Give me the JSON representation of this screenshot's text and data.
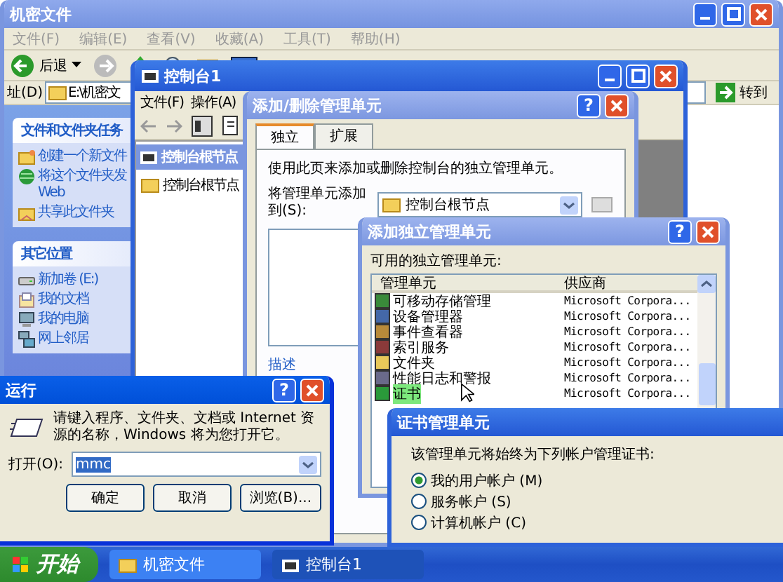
{
  "explorer": {
    "title": "机密文件",
    "menu": [
      "文件(F)",
      "编辑(E)",
      "查看(V)",
      "收藏(A)",
      "工具(T)",
      "帮助(H)"
    ],
    "toolbar": [
      {
        "kind": "back",
        "label": "后退"
      },
      {
        "kind": "forward"
      },
      {
        "kind": "up"
      },
      {
        "kind": "search"
      },
      {
        "kind": "folders"
      },
      {
        "kind": "views"
      }
    ],
    "address_label": "址(D)",
    "address": "E:\\机密文",
    "go": "转到",
    "panes": [
      {
        "title": "文件和文件夹任务",
        "items": [
          {
            "kind": "new-folder",
            "lines": [
              "创建一个新文件"
            ]
          },
          {
            "kind": "publish",
            "lines": [
              "将这个文件夹发",
              "Web"
            ]
          },
          {
            "kind": "share",
            "lines": [
              "共享此文件夹"
            ]
          }
        ]
      },
      {
        "title": "其它位置",
        "items": [
          {
            "kind": "drive",
            "lines": [
              "新加卷 (E:)"
            ]
          },
          {
            "kind": "documents",
            "lines": [
              "我的文档"
            ]
          },
          {
            "kind": "computer",
            "lines": [
              "我的电脑"
            ]
          },
          {
            "kind": "network",
            "lines": [
              "网上邻居"
            ]
          }
        ]
      }
    ]
  },
  "console": {
    "title": "控制台1",
    "menu": [
      "文件(F)",
      "操作(A)"
    ],
    "tree_header": "控制台根节点",
    "tree": [
      "控制台根节点"
    ]
  },
  "add_remove": {
    "title": "添加/删除管理单元",
    "help": "?",
    "tabs": [
      {
        "label": "独立",
        "selected": true
      },
      {
        "label": "扩展",
        "selected": false
      }
    ],
    "intro": "使用此页来添加或删除控制台的独立管理单元。",
    "add_to_label": "将管理单元添加到(S):",
    "add_to_value": "控制台根节点",
    "description_label": "描述"
  },
  "standalone": {
    "title": "添加独立管理单元",
    "help": "?",
    "available_label": "可用的独立管理单元:",
    "columns": [
      "管理单元",
      "供应商"
    ],
    "rows": [
      {
        "name": "可移动存储管理",
        "vendor": "Microsoft Corpora...",
        "selected": false
      },
      {
        "name": "设备管理器",
        "vendor": "Microsoft Corpora...",
        "selected": false
      },
      {
        "name": "事件查看器",
        "vendor": "Microsoft Corpora...",
        "selected": false
      },
      {
        "name": "索引服务",
        "vendor": "Microsoft Corpora...",
        "selected": false
      },
      {
        "name": "文件夹",
        "vendor": "Microsoft Corpora...",
        "selected": false
      },
      {
        "name": "性能日志和警报",
        "vendor": "Microsoft Corpora...",
        "selected": false
      },
      {
        "name": "证书",
        "vendor": "Microsoft Corpora...",
        "selected": true
      }
    ]
  },
  "certificate": {
    "title": "证书管理单元",
    "prompt": "该管理单元将始终为下列帐户管理证书:",
    "options": [
      {
        "label": "我的用户帐户 (M)",
        "selected": true
      },
      {
        "label": "服务帐户 (S)",
        "selected": false
      },
      {
        "label": "计算机帐户 (C)",
        "selected": false
      }
    ]
  },
  "run": {
    "title": "运行",
    "help": "?",
    "prompt": "请键入程序、文件夹、文档或 Internet 资源的名称，Windows 将为您打开它。",
    "open_label": "打开(O):",
    "value": "mmc",
    "buttons": [
      "确定",
      "取消",
      "浏览(B)..."
    ]
  },
  "taskbar": {
    "start": "开始",
    "tasks": [
      {
        "label": "机密文件",
        "selected": false
      },
      {
        "label": "控制台1",
        "selected": true
      }
    ]
  }
}
